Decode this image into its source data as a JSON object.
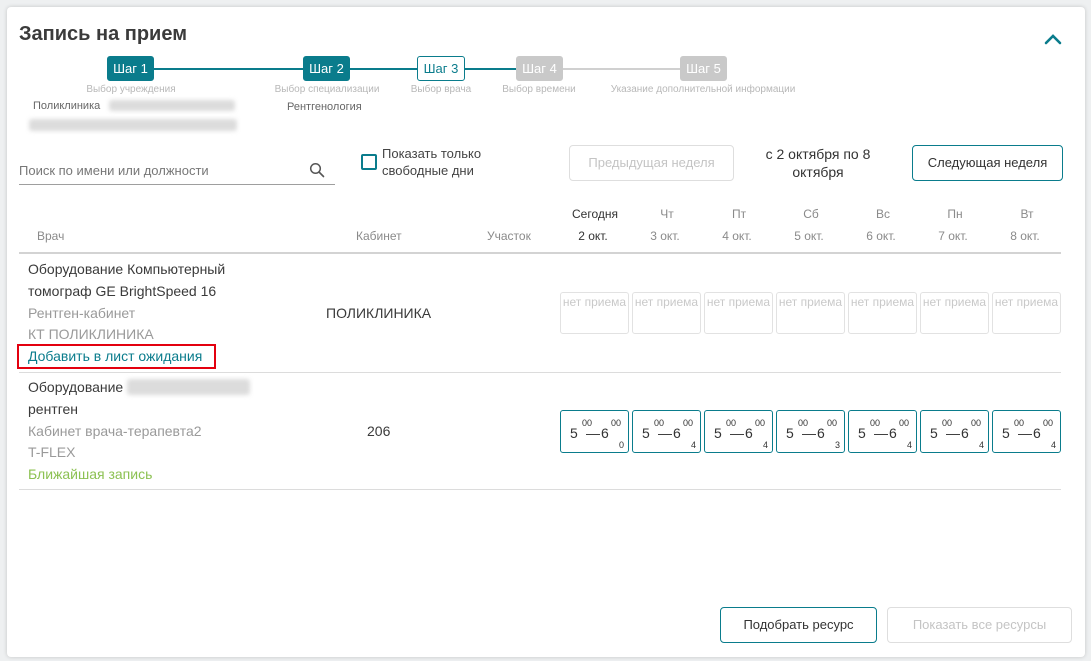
{
  "header": {
    "title": "Запись на прием"
  },
  "steps": [
    {
      "label": "Шаг 1",
      "caption": "Выбор учреждения",
      "value": "Поликлиника"
    },
    {
      "label": "Шаг 2",
      "caption": "Выбор специализации",
      "value": "Рентгенология"
    },
    {
      "label": "Шаг 3",
      "caption": "Выбор врача",
      "value": ""
    },
    {
      "label": "Шаг 4",
      "caption": "Выбор времени",
      "value": ""
    },
    {
      "label": "Шаг 5",
      "caption": "Указание дополнительной информации",
      "value": ""
    }
  ],
  "search": {
    "placeholder": "Поиск по имени или должности",
    "value": ""
  },
  "filter": {
    "free_days_label": "Показать только свободные дни",
    "checked": false
  },
  "nav": {
    "prev_label": "Предыдущая неделя",
    "week_range": "с 2 октября по 8 октября",
    "next_label": "Следующая неделя"
  },
  "table": {
    "col_doctor": "Врач",
    "col_cabinet": "Кабинет",
    "col_district": "Участок",
    "days": [
      {
        "dow": "Сегодня",
        "date": "2 окт."
      },
      {
        "dow": "Чт",
        "date": "3 окт."
      },
      {
        "dow": "Пт",
        "date": "4 окт."
      },
      {
        "dow": "Сб",
        "date": "5 окт."
      },
      {
        "dow": "Вс",
        "date": "6 окт."
      },
      {
        "dow": "Пн",
        "date": "7 окт."
      },
      {
        "dow": "Вт",
        "date": "8 окт."
      }
    ],
    "rows": [
      {
        "name_line1": "Оборудование Компьютерный",
        "name_line2": "томограф GE BrightSpeed 16",
        "room_type": "Рентген-кабинет",
        "department": "КТ ПОЛИКЛИНИКА",
        "action": "Добавить в лист ожидания",
        "cabinet": "ПОЛИКЛИНИКА",
        "no_appointment": "нет приема"
      },
      {
        "name_line1": "Оборудование",
        "name_line2": "рентген",
        "room_type": "Кабинет врача-терапевта2",
        "department": "T-FLEX",
        "action": "Ближайшая запись",
        "cabinet": "206",
        "slots": [
          {
            "from_h": "5",
            "from_m": "00",
            "to_h": "6",
            "to_m": "00",
            "count": "0"
          },
          {
            "from_h": "5",
            "from_m": "00",
            "to_h": "6",
            "to_m": "00",
            "count": "4"
          },
          {
            "from_h": "5",
            "from_m": "00",
            "to_h": "6",
            "to_m": "00",
            "count": "4"
          },
          {
            "from_h": "5",
            "from_m": "00",
            "to_h": "6",
            "to_m": "00",
            "count": "3"
          },
          {
            "from_h": "5",
            "from_m": "00",
            "to_h": "6",
            "to_m": "00",
            "count": "4"
          },
          {
            "from_h": "5",
            "from_m": "00",
            "to_h": "6",
            "to_m": "00",
            "count": "4"
          },
          {
            "from_h": "5",
            "from_m": "00",
            "to_h": "6",
            "to_m": "00",
            "count": "4"
          }
        ]
      }
    ]
  },
  "footer": {
    "select_resource": "Подобрать ресурс",
    "show_all": "Показать все ресурсы"
  },
  "colors": {
    "accent": "#0a7c8c",
    "highlight": "#e3000f",
    "green_link": "#8cc152"
  }
}
